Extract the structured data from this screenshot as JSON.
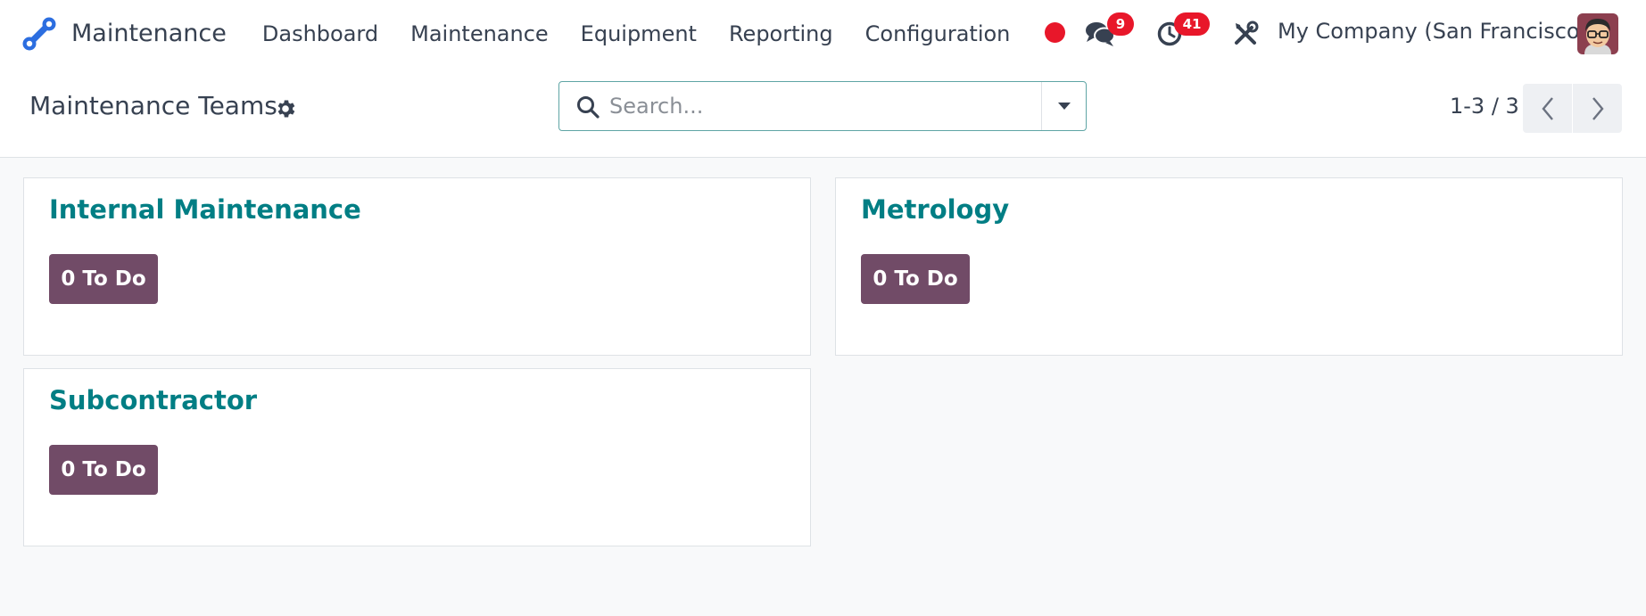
{
  "navbar": {
    "app_name": "Maintenance",
    "menu": [
      {
        "label": "Dashboard"
      },
      {
        "label": "Maintenance"
      },
      {
        "label": "Equipment"
      },
      {
        "label": "Reporting"
      },
      {
        "label": "Configuration"
      }
    ],
    "messages_badge": "9",
    "activities_badge": "41",
    "company": "My Company (San Francisco)",
    "icons": {
      "logo": "app-logo-icon",
      "recording": "record-dot-icon",
      "messages": "chat-bubbles-icon",
      "activities": "clock-icon",
      "debug": "tools-icon"
    }
  },
  "control_panel": {
    "title": "Maintenance Teams",
    "search_placeholder": "Search...",
    "pager": "1-3 / 3"
  },
  "teams": [
    {
      "name": "Internal Maintenance",
      "todo_label": "0 To Do"
    },
    {
      "name": "Metrology",
      "todo_label": "0 To Do"
    },
    {
      "name": "Subcontractor",
      "todo_label": "0 To Do"
    }
  ],
  "colors": {
    "brand_purple": "#714b67",
    "teal_title": "#017e84",
    "badge_red": "#e8172a",
    "background": "#f8f9fa"
  }
}
